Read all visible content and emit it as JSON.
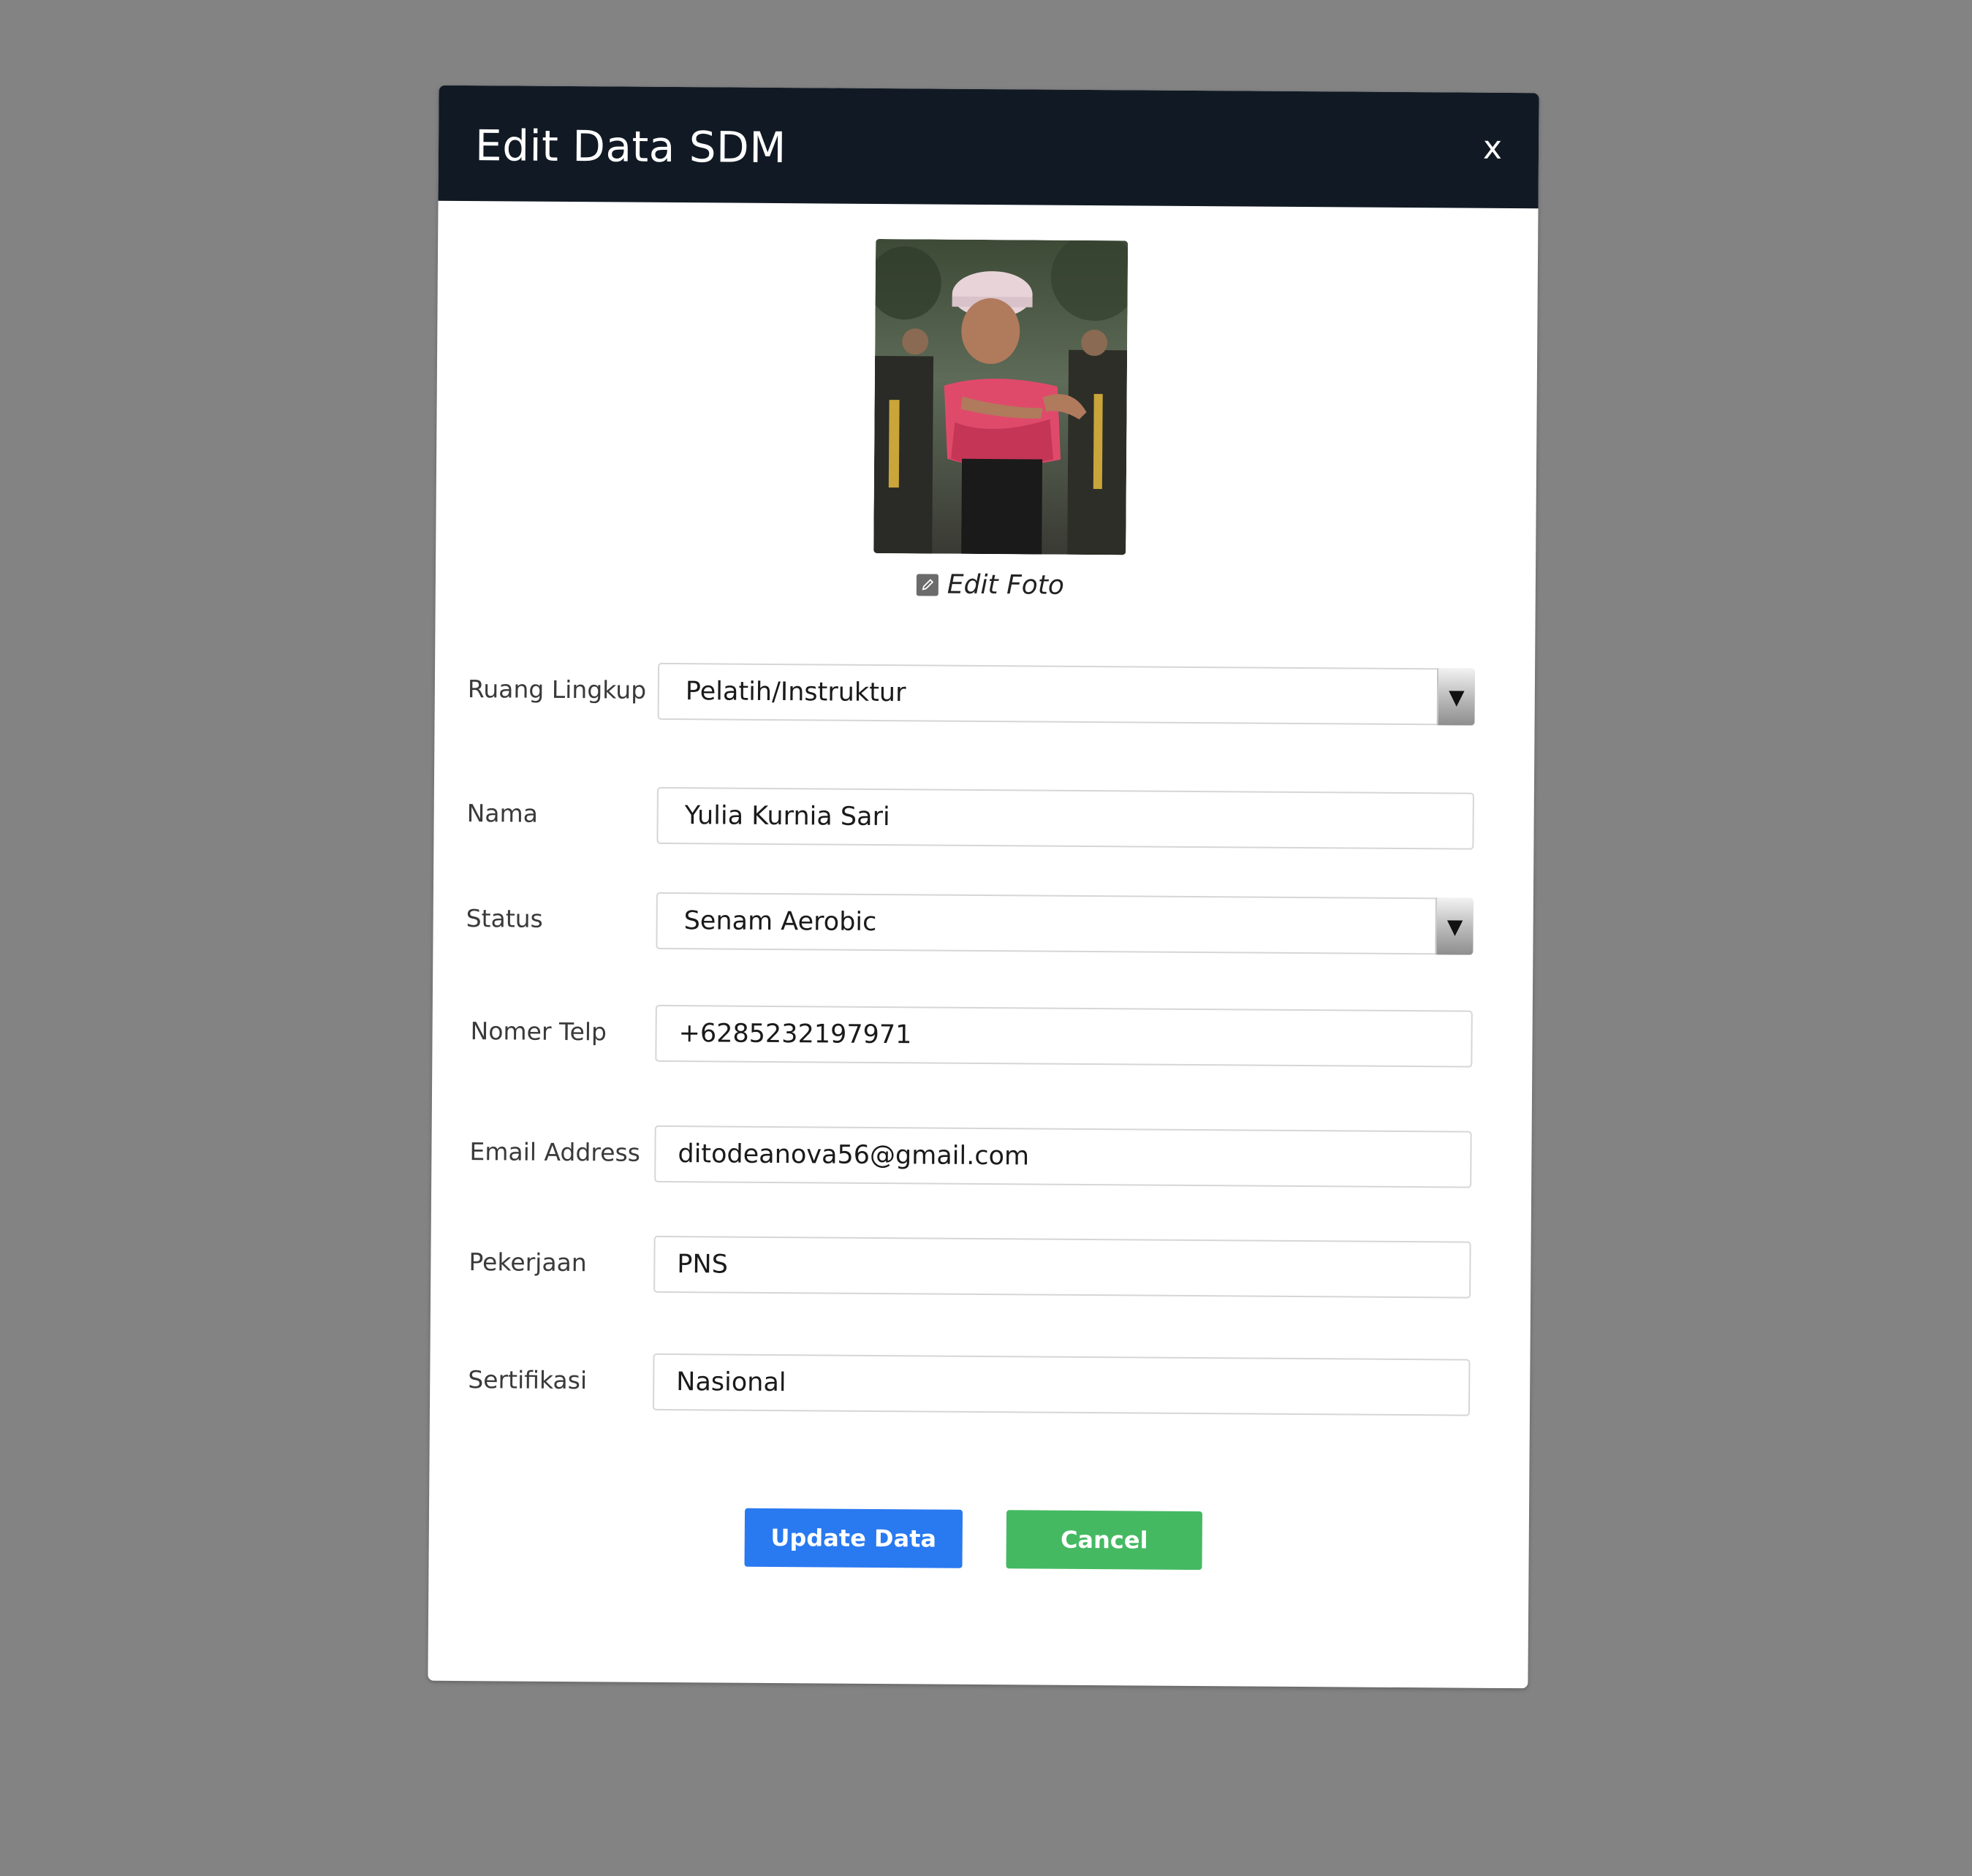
{
  "modal": {
    "title": "Edit Data SDM",
    "close_label": "x"
  },
  "photo": {
    "edit_label": "Edit Foto",
    "edit_icon": "pencil-icon"
  },
  "form": {
    "ruang_lingkup": {
      "label": "Ruang Lingkup",
      "value": "Pelatih/Instruktur"
    },
    "nama": {
      "label": "Nama",
      "value": "Yulia Kurnia Sari"
    },
    "status": {
      "label": "Status",
      "value": "Senam Aerobic"
    },
    "telp": {
      "label": "Nomer Telp",
      "value": "+6285232197971"
    },
    "email": {
      "label": "Email Address",
      "value": "ditodeanova56@gmail.com"
    },
    "pekerjaan": {
      "label": "Pekerjaan",
      "value": "PNS"
    },
    "sertifikasi": {
      "label": "Sertifikasi",
      "value": "Nasional"
    }
  },
  "buttons": {
    "update": "Update Data",
    "cancel": "Cancel"
  },
  "colors": {
    "backdrop": "#838383",
    "header": "#111a24",
    "update_button": "#2979f0",
    "cancel_button": "#45b962"
  }
}
